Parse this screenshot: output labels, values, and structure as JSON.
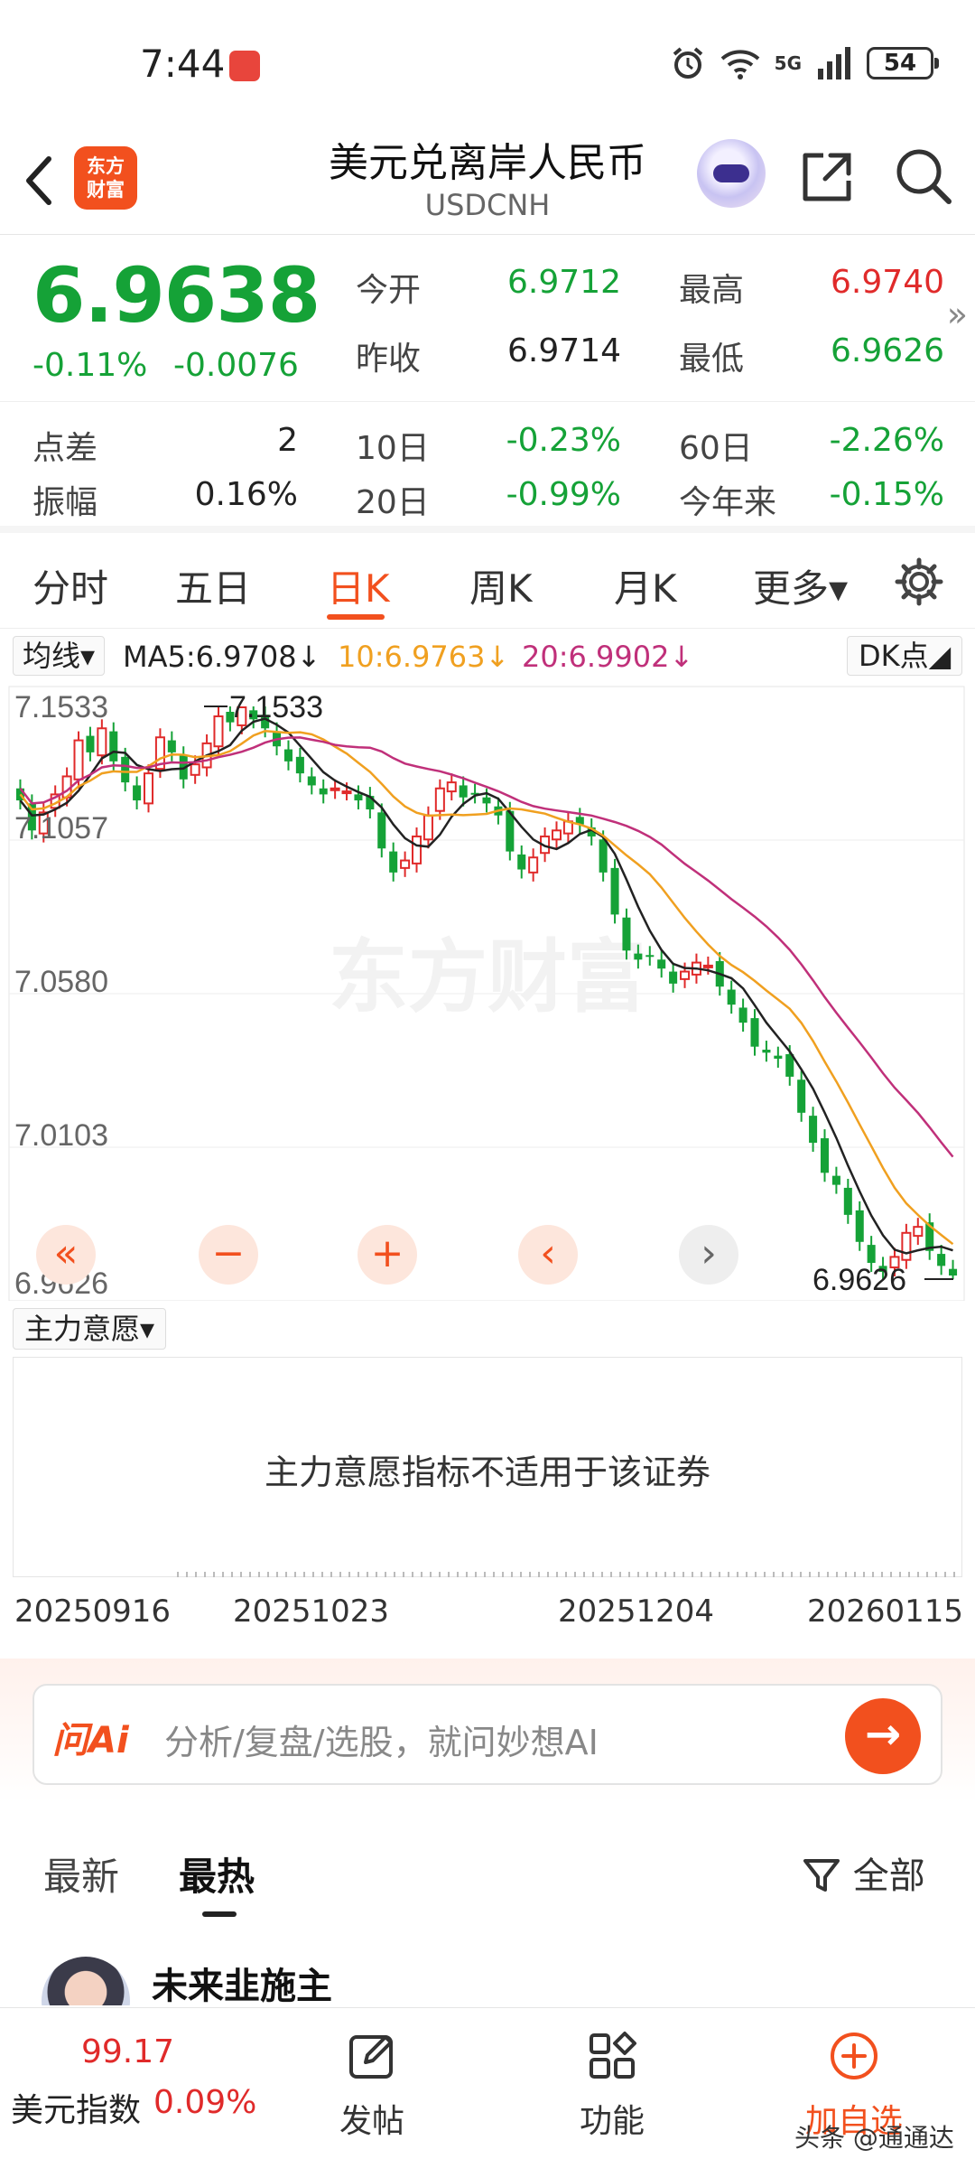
{
  "status_bar": {
    "time": "7:44",
    "network": "5G",
    "battery": "54"
  },
  "header": {
    "title": "美元兑离岸人民币",
    "subtitle": "USDCNH",
    "logo_text": "东方财富"
  },
  "quote": {
    "price": "6.9638",
    "change_pct": "-0.11%",
    "change": "-0.0076",
    "open_label": "今开",
    "open": "6.9712",
    "high_label": "最高",
    "high": "6.9740",
    "prev_close_label": "昨收",
    "prev_close": "6.9714",
    "low_label": "最低",
    "low": "6.9626"
  },
  "stats": {
    "spread_label": "点差",
    "spread": "2",
    "amplitude_label": "振幅",
    "amplitude": "0.16%",
    "d10_label": "10日",
    "d10": "-0.23%",
    "d20_label": "20日",
    "d20": "-0.99%",
    "d60_label": "60日",
    "d60": "-2.26%",
    "ytd_label": "今年来",
    "ytd": "-0.15%"
  },
  "tabs": {
    "t1": "分时",
    "t2": "五日",
    "t3": "日K",
    "t4": "周K",
    "t5": "月K",
    "more": "更多▾"
  },
  "ma": {
    "selector": "均线▾",
    "ma5": "MA5:6.9708↓",
    "ma10": "10:6.9763↓",
    "ma20": "20:6.9902↓",
    "dk": "DK点◢",
    "colors": {
      "ma5": "#222222",
      "ma10": "#f0a020",
      "ma20": "#c0307a",
      "up": "#e02a2a",
      "down": "#15a237"
    }
  },
  "chart_data": {
    "type": "candlestick",
    "y_ticks": [
      "7.1533",
      "7.1057",
      "7.0580",
      "7.0103",
      "6.9626"
    ],
    "max_label": "7.1533",
    "min_label": "6.9626",
    "ylim": [
      6.9626,
      7.1533
    ],
    "watermark": "东方财富",
    "x_labels": [
      "20250916",
      "20251023",
      "20251204",
      "20260115"
    ],
    "closes": [
      7.122,
      7.112,
      7.118,
      7.124,
      7.13,
      7.142,
      7.138,
      7.146,
      7.135,
      7.128,
      7.122,
      7.131,
      7.143,
      7.138,
      7.129,
      7.134,
      7.141,
      7.15,
      7.148,
      7.153,
      7.149,
      7.146,
      7.14,
      7.135,
      7.131,
      7.127,
      7.124,
      7.126,
      7.125,
      7.122,
      7.119,
      7.106,
      7.098,
      7.102,
      7.11,
      7.117,
      7.126,
      7.128,
      7.123,
      7.124,
      7.121,
      7.117,
      7.105,
      7.099,
      7.103,
      7.11,
      7.112,
      7.115,
      7.114,
      7.11,
      7.098,
      7.084,
      7.072,
      7.069,
      7.07,
      7.066,
      7.061,
      7.065,
      7.068,
      7.067,
      7.06,
      7.054,
      7.048,
      7.04,
      7.038,
      7.036,
      7.03,
      7.018,
      7.008,
      6.998,
      6.994,
      6.984,
      6.975,
      6.968,
      6.965,
      6.97,
      6.978,
      6.98,
      6.972,
      6.967,
      6.9638
    ]
  },
  "indicator": {
    "selector": "主力意愿▾",
    "message": "主力意愿指标不适用于该证券"
  },
  "ai": {
    "logo": "问Ai",
    "placeholder": "分析/复盘/选股，就问妙想AI"
  },
  "feed": {
    "latest": "最新",
    "hottest": "最热",
    "filter": "全部"
  },
  "post": {
    "author": "未来韭施主"
  },
  "bottom_nav": {
    "index_value": "99.17",
    "index_name": "美元指数",
    "index_pct": "0.09%",
    "post_label": "发帖",
    "func_label": "功能",
    "add_label": "加自选",
    "watermark": "头条 @通通达"
  }
}
